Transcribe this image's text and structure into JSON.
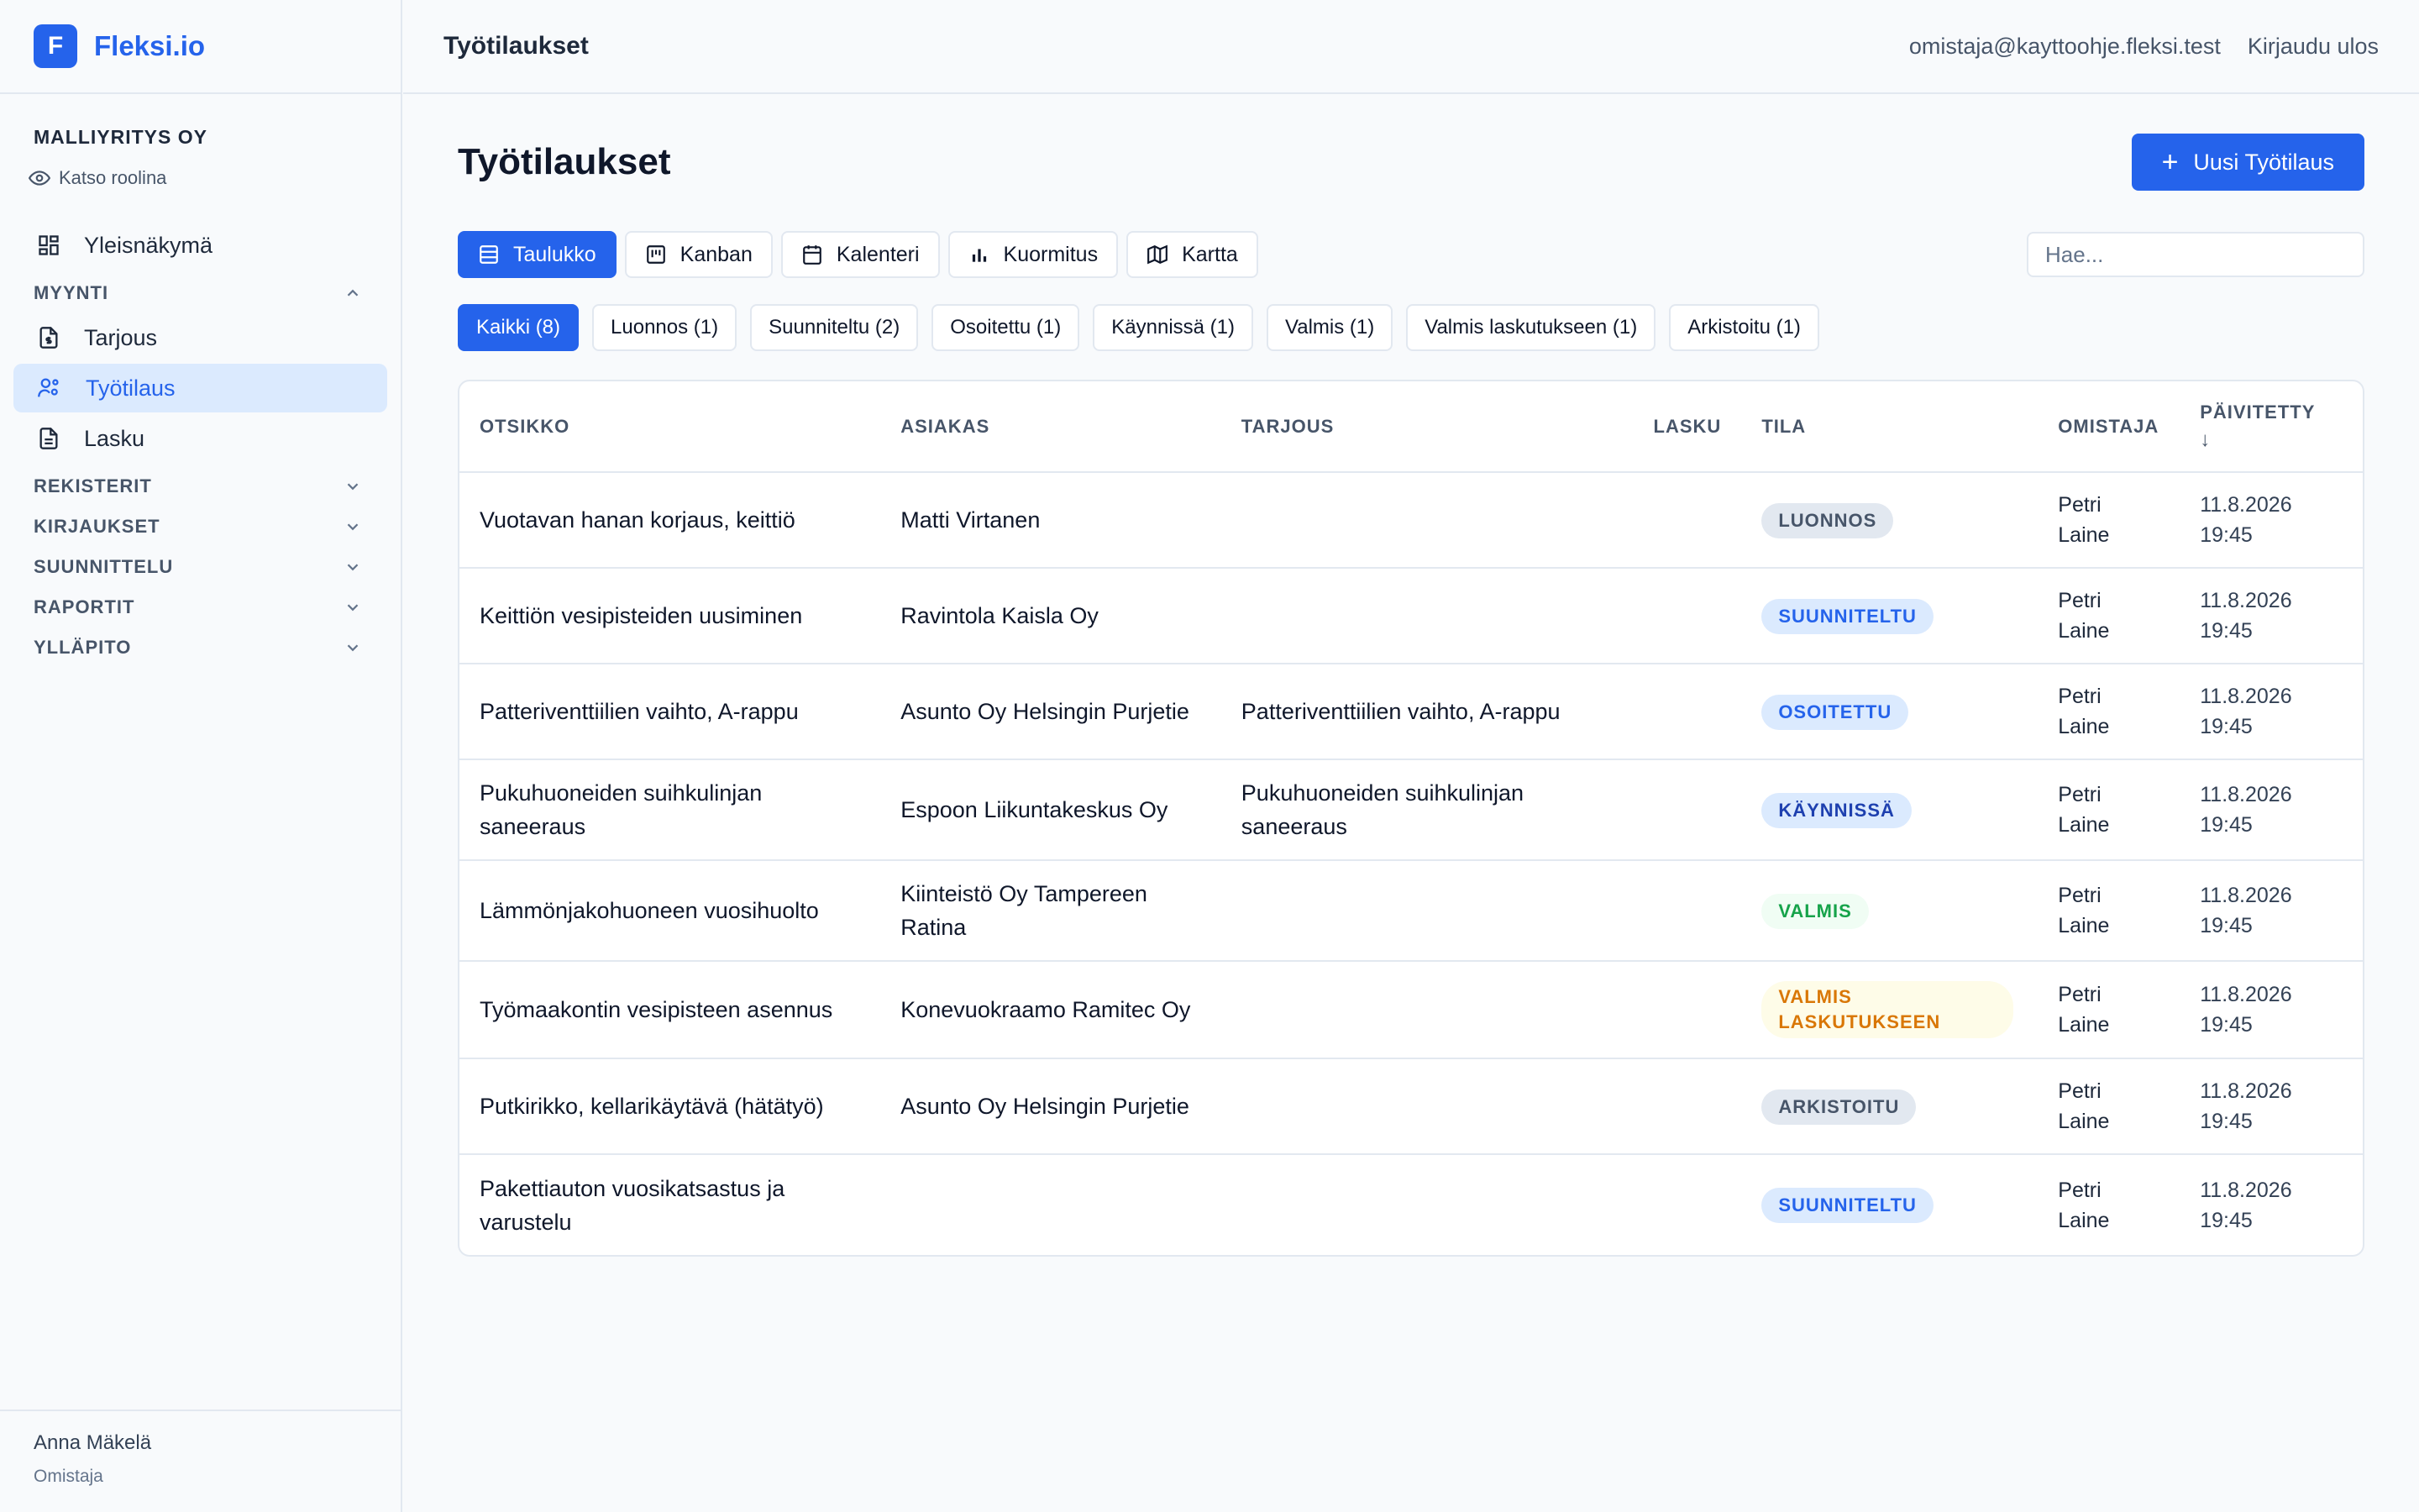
{
  "brand": {
    "logo_letter": "F",
    "name": "Fleksi.io"
  },
  "company": {
    "name": "MALLIYRITYS OY",
    "view_role": "Katso roolina"
  },
  "nav": {
    "overview": "Yleisnäkymä",
    "sections": {
      "myynti": "MYYNTI",
      "rekisterit": "REKISTERIT",
      "kirjaukset": "KIRJAUKSET",
      "suunnittelu": "SUUNNITTELU",
      "raportit": "RAPORTIT",
      "yllapito": "YLLÄPITO"
    },
    "myynti_items": [
      "Tarjous",
      "Työtilaus",
      "Lasku"
    ]
  },
  "user": {
    "name": "Anna Mäkelä",
    "role": "Omistaja"
  },
  "topbar": {
    "title": "Työtilaukset",
    "email": "omistaja@kayttoohje.fleksi.test",
    "logout": "Kirjaudu ulos"
  },
  "page": {
    "title": "Työtilaukset",
    "new_button": "Uusi Työtilaus",
    "plus": "+"
  },
  "views": [
    "Taulukko",
    "Kanban",
    "Kalenteri",
    "Kuormitus",
    "Kartta"
  ],
  "search": {
    "placeholder": "Hae..."
  },
  "filters": [
    "Kaikki (8)",
    "Luonnos (1)",
    "Suunniteltu (2)",
    "Osoitettu (1)",
    "Käynnissä (1)",
    "Valmis (1)",
    "Valmis laskutukseen (1)",
    "Arkistoitu (1)"
  ],
  "table": {
    "headers": [
      "OTSIKKO",
      "ASIAKAS",
      "TARJOUS",
      "LASKU",
      "TILA",
      "OMISTAJA",
      "PÄIVITETTY"
    ],
    "sort_arrow": "↓",
    "rows": [
      {
        "title": "Vuotavan hanan korjaus, keittiö",
        "customer": "Matti Virtanen",
        "offer": "",
        "invoice": "",
        "status": "LUONNOS",
        "owner": "Petri Laine",
        "updated": "11.8.2026 19:45"
      },
      {
        "title": "Keittiön vesipisteiden uusiminen",
        "customer": "Ravintola Kaisla Oy",
        "offer": "",
        "invoice": "",
        "status": "SUUNNITELTU",
        "owner": "Petri Laine",
        "updated": "11.8.2026 19:45"
      },
      {
        "title": "Patteriventtiilien vaihto, A-rappu",
        "customer": "Asunto Oy Helsingin Purjetie",
        "offer": "Patteriventtiilien vaihto, A-rappu",
        "invoice": "",
        "status": "OSOITETTU",
        "owner": "Petri Laine",
        "updated": "11.8.2026 19:45"
      },
      {
        "title": "Pukuhuoneiden suihkulinjan saneeraus",
        "customer": "Espoon Liikuntakeskus Oy",
        "offer": "Pukuhuoneiden suihkulinjan saneeraus",
        "invoice": "",
        "status": "KÄYNNISSÄ",
        "owner": "Petri Laine",
        "updated": "11.8.2026 19:45"
      },
      {
        "title": "Lämmönjakohuoneen vuosihuolto",
        "customer": "Kiinteistö Oy Tampereen Ratina",
        "offer": "",
        "invoice": "",
        "status": "VALMIS",
        "owner": "Petri Laine",
        "updated": "11.8.2026 19:45"
      },
      {
        "title": "Työmaakontin vesipisteen asennus",
        "customer": "Konevuokraamo Ramitec Oy",
        "offer": "",
        "invoice": "",
        "status": "VALMIS LASKUTUKSEEN",
        "owner": "Petri Laine",
        "updated": "11.8.2026 19:45"
      },
      {
        "title": "Putkirikko, kellarikäytävä (hätätyö)",
        "customer": "Asunto Oy Helsingin Purjetie",
        "offer": "",
        "invoice": "",
        "status": "ARKISTOITU",
        "owner": "Petri Laine",
        "updated": "11.8.2026 19:45"
      },
      {
        "title": "Pakettiauton vuosikatsastus ja varustelu",
        "customer": "",
        "offer": "",
        "invoice": "",
        "status": "SUUNNITELTU",
        "owner": "Petri Laine",
        "updated": "11.8.2026 19:45"
      }
    ]
  },
  "colors": {
    "accent": "#2563eb",
    "status": {
      "LUONNOS": {
        "bg": "#e2e8f0",
        "fg": "#475569"
      },
      "SUUNNITELTU": {
        "bg": "#dbeafe",
        "fg": "#2563eb"
      },
      "OSOITETTU": {
        "bg": "#dbeafe",
        "fg": "#2563eb"
      },
      "KÄYNNISSÄ": {
        "bg": "#dbeafe",
        "fg": "#1e40af"
      },
      "VALMIS": {
        "bg": "#f0fdf4",
        "fg": "#16a34a"
      },
      "VALMIS LASKUTUKSEEN": {
        "bg": "#fefce8",
        "fg": "#d97706"
      },
      "ARKISTOITU": {
        "bg": "#e2e8f0",
        "fg": "#475569"
      }
    }
  },
  "icons": {
    "overview": "dashboard-icon",
    "tarjous": "document-dollar-icon",
    "tyotilaus": "user-cog-icon",
    "lasku": "document-icon",
    "view_role": "eye-icon",
    "views": [
      "table-icon",
      "kanban-icon",
      "calendar-icon",
      "bar-chart-icon",
      "map-icon"
    ]
  }
}
